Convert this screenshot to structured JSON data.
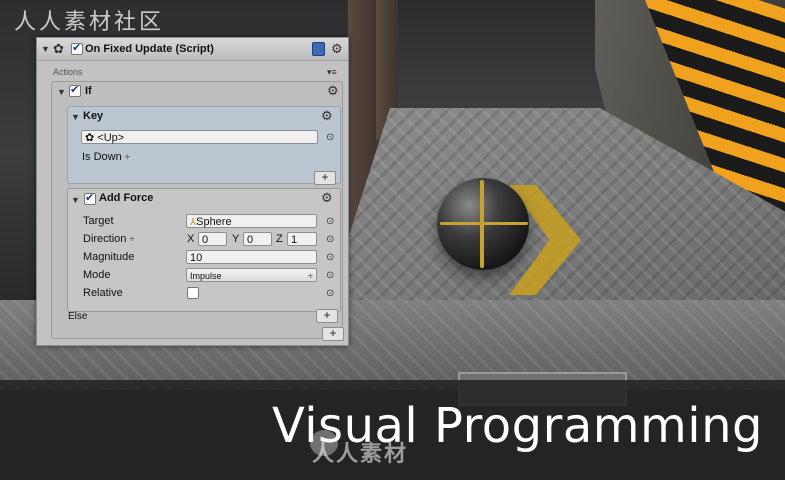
{
  "watermark": {
    "top_text": "人人素材社区",
    "bottom_text": "人人素材"
  },
  "caption": "Visual Programming",
  "inspector": {
    "header_title": "On Fixed Update (Script)",
    "actions_label": "Actions",
    "if_block": {
      "title": "If",
      "key_block": {
        "title": "Key",
        "key_value": "<Up>",
        "condition": "Is Down",
        "condition_arrow": "÷"
      },
      "add_force_block": {
        "title": "Add Force",
        "rows": {
          "target_label": "Target",
          "target_value": "Sphere",
          "direction_label": "Direction",
          "direction_arrow": "÷",
          "x_label": "X",
          "x_value": "0",
          "y_label": "Y",
          "y_value": "0",
          "z_label": "Z",
          "z_value": "1",
          "magnitude_label": "Magnitude",
          "magnitude_value": "10",
          "mode_label": "Mode",
          "mode_value": "Impulse",
          "mode_arrow": "÷",
          "relative_label": "Relative",
          "relative_checked": false
        }
      },
      "else_label": "Else"
    },
    "add_buttons": [
      "+",
      "+",
      "+"
    ]
  },
  "colors": {
    "panel_bg": "#c2c2c2",
    "key_box_bg": "#bcc6d1",
    "stripe_yellow": "#f0a21e",
    "ball_line": "#c7a233"
  }
}
